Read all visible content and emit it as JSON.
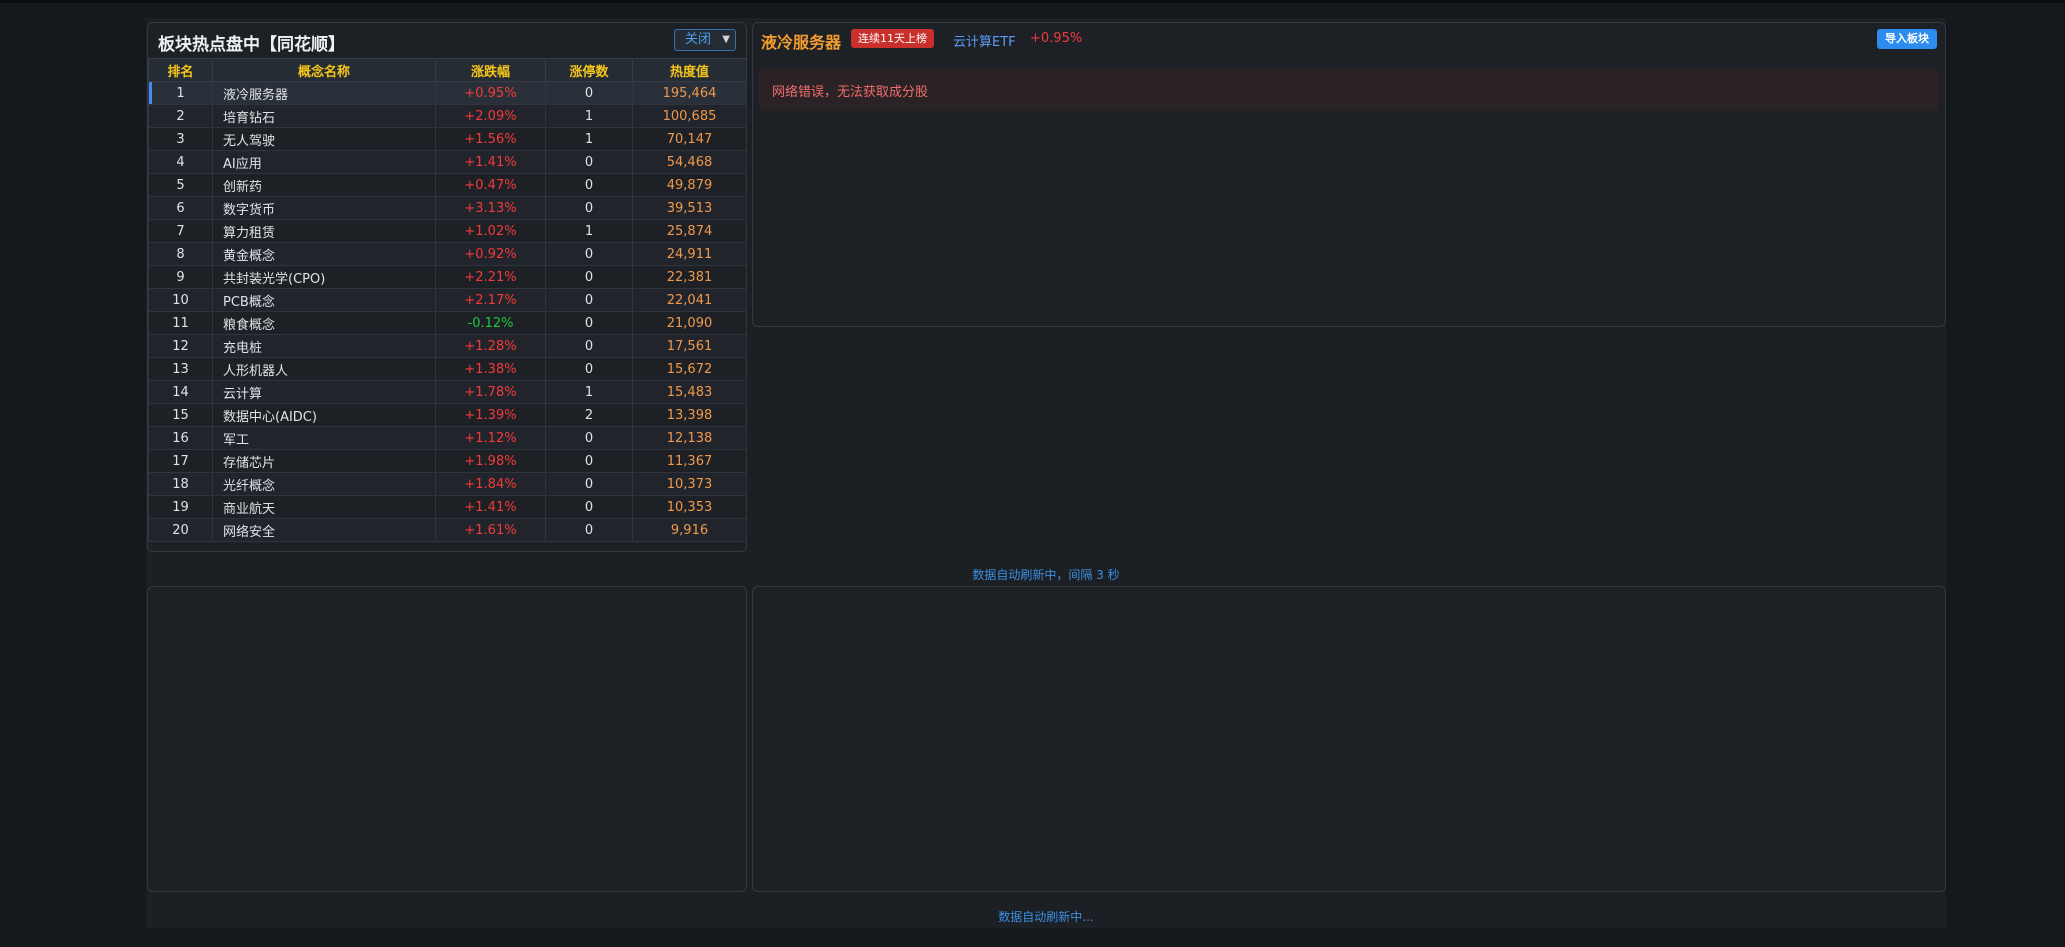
{
  "rank_panel": {
    "title": "板块热点盘中【同花顺】",
    "select_value": "关闭",
    "columns": [
      "排名",
      "概念名称",
      "涨跌幅",
      "涨停数",
      "热度值"
    ],
    "rows": [
      {
        "rank": "1",
        "name": "液冷服务器",
        "change": "+0.95%",
        "limit_up": "0",
        "heat": "195,464"
      },
      {
        "rank": "2",
        "name": "培育钻石",
        "change": "+2.09%",
        "limit_up": "1",
        "heat": "100,685"
      },
      {
        "rank": "3",
        "name": "无人驾驶",
        "change": "+1.56%",
        "limit_up": "1",
        "heat": "70,147"
      },
      {
        "rank": "4",
        "name": "AI应用",
        "change": "+1.41%",
        "limit_up": "0",
        "heat": "54,468"
      },
      {
        "rank": "5",
        "name": "创新药",
        "change": "+0.47%",
        "limit_up": "0",
        "heat": "49,879"
      },
      {
        "rank": "6",
        "name": "数字货币",
        "change": "+3.13%",
        "limit_up": "0",
        "heat": "39,513"
      },
      {
        "rank": "7",
        "name": "算力租赁",
        "change": "+1.02%",
        "limit_up": "1",
        "heat": "25,874"
      },
      {
        "rank": "8",
        "name": "黄金概念",
        "change": "+0.92%",
        "limit_up": "0",
        "heat": "24,911"
      },
      {
        "rank": "9",
        "name": "共封装光学(CPO)",
        "change": "+2.21%",
        "limit_up": "0",
        "heat": "22,381"
      },
      {
        "rank": "10",
        "name": "PCB概念",
        "change": "+2.17%",
        "limit_up": "0",
        "heat": "22,041"
      },
      {
        "rank": "11",
        "name": "粮食概念",
        "change": "-0.12%",
        "limit_up": "0",
        "heat": "21,090"
      },
      {
        "rank": "12",
        "name": "充电桩",
        "change": "+1.28%",
        "limit_up": "0",
        "heat": "17,561"
      },
      {
        "rank": "13",
        "name": "人形机器人",
        "change": "+1.38%",
        "limit_up": "0",
        "heat": "15,672"
      },
      {
        "rank": "14",
        "name": "云计算",
        "change": "+1.78%",
        "limit_up": "1",
        "heat": "15,483"
      },
      {
        "rank": "15",
        "name": "数据中心(AIDC)",
        "change": "+1.39%",
        "limit_up": "2",
        "heat": "13,398"
      },
      {
        "rank": "16",
        "name": "军工",
        "change": "+1.12%",
        "limit_up": "0",
        "heat": "12,138"
      },
      {
        "rank": "17",
        "name": "存储芯片",
        "change": "+1.98%",
        "limit_up": "0",
        "heat": "11,367"
      },
      {
        "rank": "18",
        "name": "光纤概念",
        "change": "+1.84%",
        "limit_up": "0",
        "heat": "10,373"
      },
      {
        "rank": "19",
        "name": "商业航天",
        "change": "+1.41%",
        "limit_up": "0",
        "heat": "10,353"
      },
      {
        "rank": "20",
        "name": "网络安全",
        "change": "+1.61%",
        "limit_up": "0",
        "heat": "9,916"
      }
    ]
  },
  "detail_panel": {
    "name": "液冷服务器",
    "streak_badge": "连续11天上榜",
    "etf_name": "云计算ETF",
    "etf_change": "+0.95%",
    "import_button": "导入板块",
    "error_message": "网络错误，无法获取成分股"
  },
  "refresh_top": "数据自动刷新中，间隔 3 秒",
  "refresh_bottom": "数据自动刷新中...",
  "colors": {
    "up": "#f23a3a",
    "down": "#20c83a",
    "heat": "#f0984a",
    "header_text": "#f3c51c",
    "accent": "#2d8cf0"
  }
}
